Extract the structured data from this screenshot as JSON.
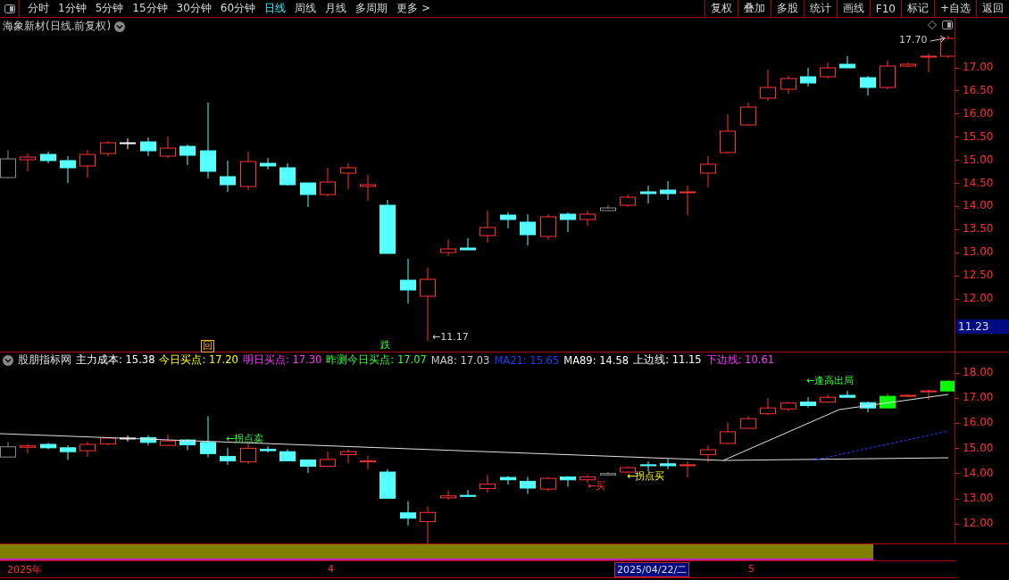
{
  "toolbar": {
    "periods": [
      {
        "label": "分时",
        "selected": false
      },
      {
        "label": "1分钟",
        "selected": false
      },
      {
        "label": "5分钟",
        "selected": false
      },
      {
        "label": "15分钟",
        "selected": false
      },
      {
        "label": "30分钟",
        "selected": false
      },
      {
        "label": "60分钟",
        "selected": false
      },
      {
        "label": "日线",
        "selected": true
      },
      {
        "label": "周线",
        "selected": false
      },
      {
        "label": "月线",
        "selected": false
      },
      {
        "label": "多周期",
        "selected": false
      },
      {
        "label": "更多 >",
        "selected": false
      }
    ],
    "buttons": [
      "复权",
      "叠加",
      "多股",
      "统计",
      "画线",
      "F10",
      "标记",
      "+自选",
      "返回"
    ]
  },
  "main_chart": {
    "title": "海象新材(日线.前复权)",
    "annotations": [
      "17.70",
      "←11.17"
    ],
    "markers": [
      {
        "label": "回",
        "kind": "boxed"
      },
      {
        "label": "跌",
        "kind": "plain"
      }
    ],
    "axis_ticks": [
      "17.00",
      "16.50",
      "16.00",
      "15.50",
      "15.00",
      "14.50",
      "14.00",
      "13.50",
      "13.00",
      "12.50",
      "12.00"
    ],
    "current_price": "11.23"
  },
  "indicator": {
    "name": "股朋指标网",
    "legend": [
      {
        "text": "主力成本: 15.38",
        "color": "#ffffff"
      },
      {
        "text": "今日买点: 17.20",
        "color": "#ffff00"
      },
      {
        "text": "明日买点: 17.30",
        "color": "#ff33ff"
      },
      {
        "text": "昨测今日买点: 17.07",
        "color": "#33ff33"
      },
      {
        "text": "MA8: 17.03",
        "color": "#cccccc"
      },
      {
        "text": "MA21: 15.65",
        "color": "#1f3fff"
      },
      {
        "text": "MA89: 14.58",
        "color": "#ffffff"
      },
      {
        "text": "上边线: 11.15",
        "color": "#ffffff"
      },
      {
        "text": "下边线: 10.61",
        "color": "#ff33ff"
      }
    ],
    "annotations": [
      {
        "text": "←拐点卖",
        "color": "#33ff33"
      },
      {
        "text": "←买",
        "color": "#ff3333"
      },
      {
        "text": "←拐点买",
        "color": "#ffff00"
      },
      {
        "text": "←逢高出局",
        "color": "#33ff33"
      }
    ],
    "axis_ticks": [
      "18.00",
      "17.00",
      "16.00",
      "15.00",
      "14.00",
      "13.00",
      "12.00"
    ]
  },
  "time_axis": [
    {
      "label": "2025年",
      "kind": "plain"
    },
    {
      "label": "4",
      "kind": "plain"
    },
    {
      "label": "2025/04/22/二",
      "kind": "cursor"
    },
    {
      "label": "5",
      "kind": "plain"
    }
  ]
}
